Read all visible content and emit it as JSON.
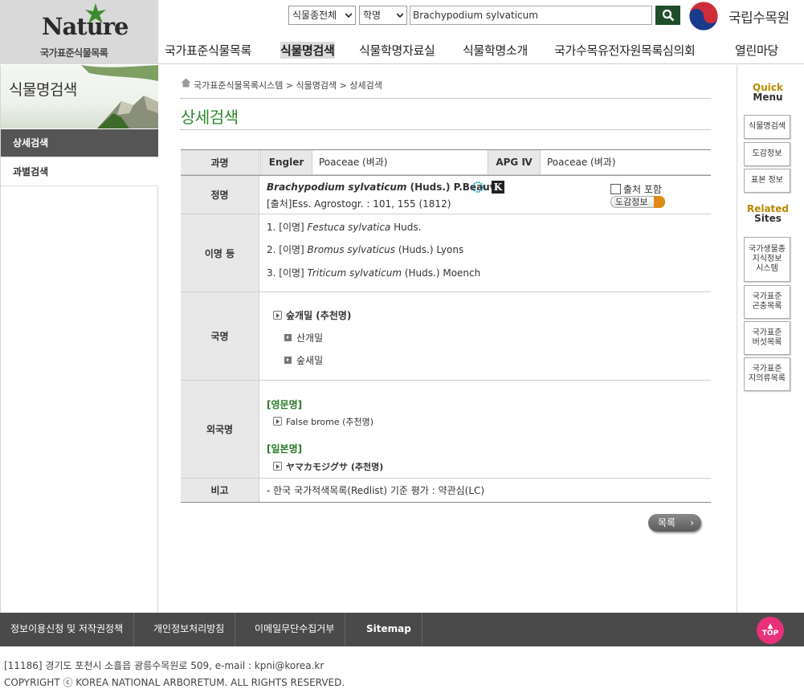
{
  "header": {
    "logo_text": "Nature",
    "logo_sub": "국가표준식물목록",
    "search": {
      "scope": "식물종전체",
      "field": "학명",
      "query": "Brachypodium sylvaticum"
    },
    "org_name": "국립수목원",
    "nav": [
      "국가표준식물목록",
      "식물명검색",
      "식물학명자료실",
      "식물학명소개",
      "국가수목유전자원목록심의회",
      "열린마당"
    ]
  },
  "left": {
    "title": "식물명검색",
    "menu": [
      "상세검색",
      "과별검색"
    ]
  },
  "breadcrumb": "국가표준식물목록시스템 > 식물명검색 > 상세검색",
  "page_title": "상세검색",
  "detail": {
    "family": {
      "label": "과명",
      "engler_label": "Engler",
      "engler_value": "Poaceae (벼과)",
      "apg_label": "APG Ⅳ",
      "apg_value": "Poaceae (벼과)"
    },
    "accepted": {
      "label": "정명",
      "genus_species": "Brachypodium sylvaticum",
      "author": "(Huds.) P.Beauv.",
      "k_badge": "K",
      "source": "[출처]Ess. Agrostogr. : 101, 155 (1812)",
      "include_source": "출처 포함",
      "book_info": "도감정보"
    },
    "synonyms": {
      "label": "이명 등",
      "items": [
        {
          "prefix": "1. [이명] ",
          "name": "Festuca sylvatica",
          "author": " Huds."
        },
        {
          "prefix": "2. [이명] ",
          "name": "Bromus sylvaticus",
          "author": " (Huds.) Lyons"
        },
        {
          "prefix": "3. [이명] ",
          "name": "Triticum sylvaticum",
          "author": " (Huds.) Moench"
        }
      ]
    },
    "korean": {
      "label": "국명",
      "recommended": "숲개밀 (추천명)",
      "others": [
        "산개밀",
        "숲새밀"
      ]
    },
    "foreign": {
      "label": "외국명",
      "en_header": "[영문명]",
      "en_name": "False brome (추천명)",
      "jp_header": "[일본명]",
      "jp_name": "ヤマカモジグサ (추천명)"
    },
    "remark": {
      "label": "비고",
      "text": "- 한국 국가적색목록(Redlist) 기준 평가 : 약관심(LC)"
    }
  },
  "list_button": "목록",
  "quick": {
    "title_a": "Quick",
    "title_b": "Menu",
    "items": [
      "식물명검색",
      "도감정보",
      "표본 정보"
    ],
    "related_a": "Related",
    "related_b": "Sites",
    "sites": [
      "국가생물종\n지식정보\n시스템",
      "국가표준\n곤충목록",
      "국가표준\n버섯목록",
      "국가표준\n지의류목록"
    ]
  },
  "footer": {
    "links": [
      "정보이용신청 및 저작권정책",
      "개인정보처리방침",
      "이메일무단수집거부",
      "Sitemap"
    ],
    "top": "TOP",
    "address": "[11186] 경기도 포천시 소흘읍 광릉수목원로 509, e-mail : kpni@korea.kr",
    "copyright": "COPYRIGHT ⓒ KOREA NATIONAL ARBORETUM. ALL RIGHTS RESERVED."
  },
  "colors": {
    "title_green": "#2d8a2d",
    "footer_bg": "#4a4a4a",
    "top_button": "#e8317a",
    "search_button": "#1f4d2b"
  }
}
